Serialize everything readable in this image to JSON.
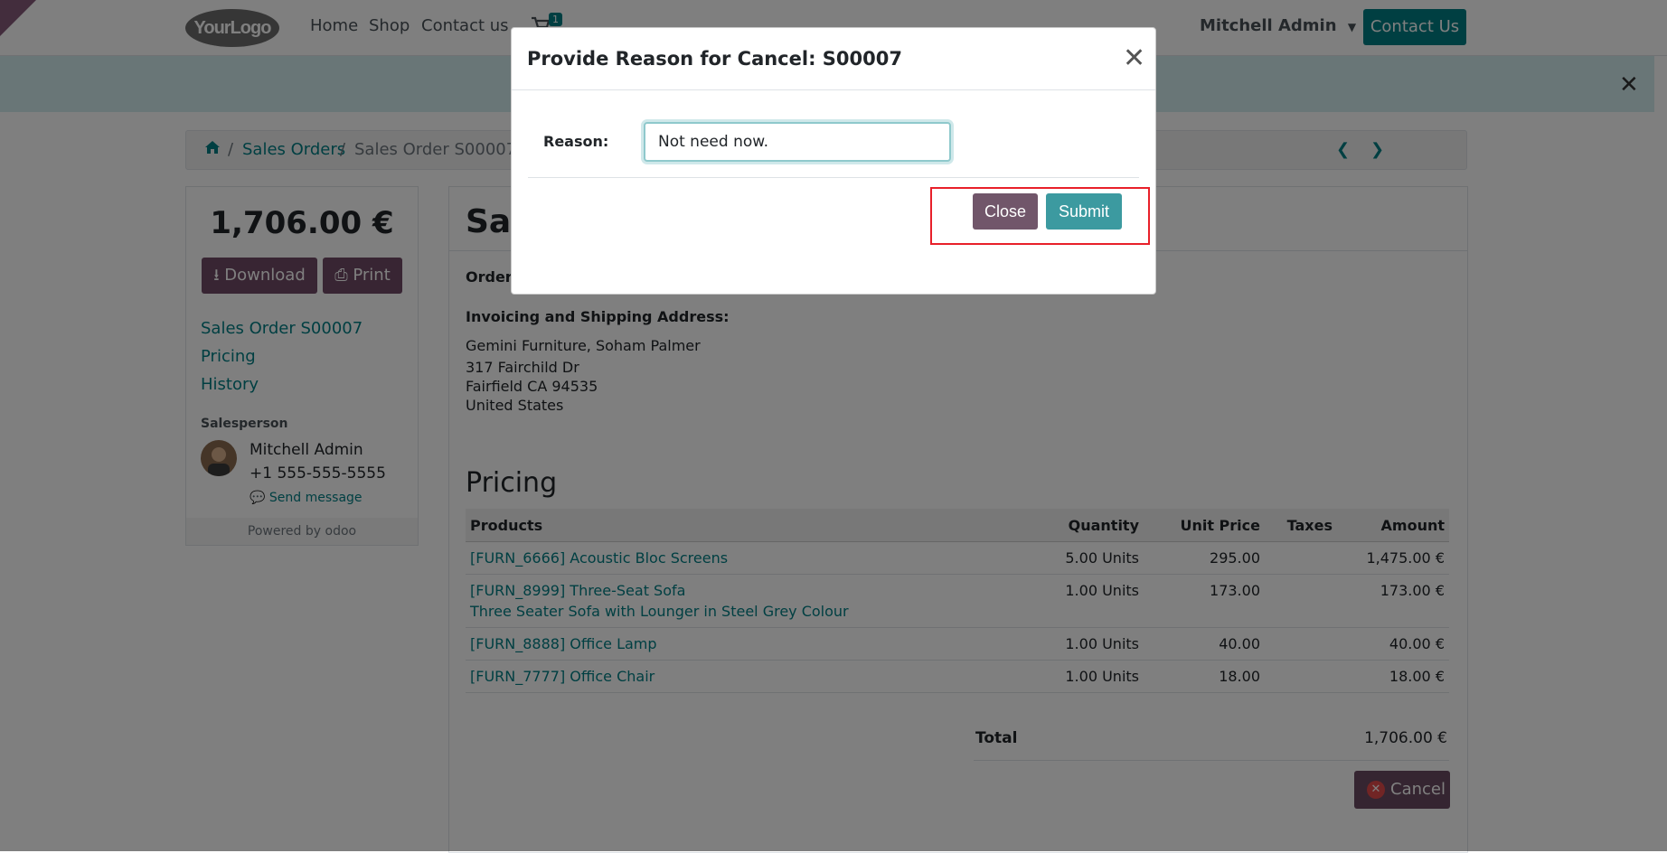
{
  "navbar": {
    "logo": "YourLogo",
    "links": [
      "Home",
      "Shop",
      "Contact us"
    ],
    "cart_count": "1",
    "user": "Mitchell Admin",
    "contact_button": "Contact Us"
  },
  "breadcrumb": {
    "items": [
      "Sales Orders",
      "Sales Order S00007"
    ]
  },
  "sidebar": {
    "amount": "1,706.00 €",
    "download_label": "Download",
    "print_label": "Print",
    "links": [
      "Sales Order S00007",
      "Pricing",
      "History"
    ],
    "salesperson_title": "Salesperson",
    "salesperson_name": "Mitchell Admin",
    "salesperson_phone": "+1 555-555-5555",
    "send_message": "Send message",
    "powered_by": "Powered by odoo"
  },
  "main": {
    "title_partial": "Sal",
    "order_label_partial": "Order",
    "address_heading": "Invoicing and Shipping Address:",
    "address_lines": [
      "Gemini Furniture, Soham Palmer",
      "317 Fairchild Dr",
      "Fairfield CA 94535",
      "United States"
    ],
    "pricing_heading": "Pricing",
    "table": {
      "headers": [
        "Products",
        "Quantity",
        "Unit Price",
        "Taxes",
        "Amount"
      ],
      "rows": [
        {
          "product": "[FURN_6666] Acoustic Bloc Screens",
          "desc": "",
          "qty": "5.00 Units",
          "price": "295.00",
          "taxes": "",
          "amount": "1,475.00 €"
        },
        {
          "product": "[FURN_8999] Three-Seat Sofa",
          "desc": "Three Seater Sofa with Lounger in Steel Grey Colour",
          "qty": "1.00 Units",
          "price": "173.00",
          "taxes": "",
          "amount": "173.00 €"
        },
        {
          "product": "[FURN_8888] Office Lamp",
          "desc": "",
          "qty": "1.00 Units",
          "price": "40.00",
          "taxes": "",
          "amount": "40.00 €"
        },
        {
          "product": "[FURN_7777] Office Chair",
          "desc": "",
          "qty": "1.00 Units",
          "price": "18.00",
          "taxes": "",
          "amount": "18.00 €"
        }
      ]
    },
    "total_label": "Total",
    "total_value": "1,706.00 €",
    "cancel_label": "Cancel"
  },
  "modal": {
    "title": "Provide Reason for Cancel: S00007",
    "reason_label": "Reason:",
    "reason_value": "Not need now.",
    "close_label": "Close",
    "submit_label": "Submit"
  },
  "colors": {
    "accent": "#017e84",
    "brand": "#714b67",
    "highlight": "#e8202a"
  }
}
